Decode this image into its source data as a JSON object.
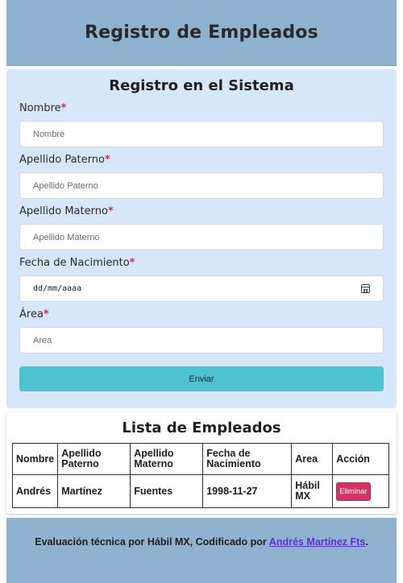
{
  "header": {
    "title": "Registro de Empleados"
  },
  "form": {
    "title": "Registro en el Sistema",
    "required_mark": "*",
    "fields": [
      {
        "label": "Nombre",
        "placeholder": "Nombre"
      },
      {
        "label": "Apellido Paterno",
        "placeholder": "Apellido Paterno"
      },
      {
        "label": "Apellido Materno",
        "placeholder": "Apellido Materno"
      },
      {
        "label": "Fecha de Nacimiento",
        "placeholder": "dd/mm/aaaa",
        "icon": "calendar-icon"
      },
      {
        "label": "Área",
        "placeholder": "Area"
      }
    ],
    "submit_label": "Enviar"
  },
  "list": {
    "title": "Lista de Empleados",
    "columns": [
      "Nombre",
      "Apellido Paterno",
      "Apellido Materno",
      "Fecha de Nacimiento",
      "Area",
      "Acción"
    ],
    "rows": [
      {
        "nombre": "Andrés",
        "apellido_paterno": "Martínez",
        "apellido_materno": "Fuentes",
        "fecha": "1998-11-27",
        "area": "Hábil MX",
        "accion": "Eliminar"
      }
    ]
  },
  "footer": {
    "text": "Evaluación técnica por Hábil MX, Codificado por ",
    "link_text": "Andrés Martínez Fts",
    "suffix": "."
  },
  "colors": {
    "header_bg": "#8fb2d1",
    "form_bg": "#d5e7f8",
    "submit_bg": "#4dc3cf",
    "delete_bg": "#d63263",
    "required": "#d12c5a",
    "link": "#5b2fd8"
  }
}
